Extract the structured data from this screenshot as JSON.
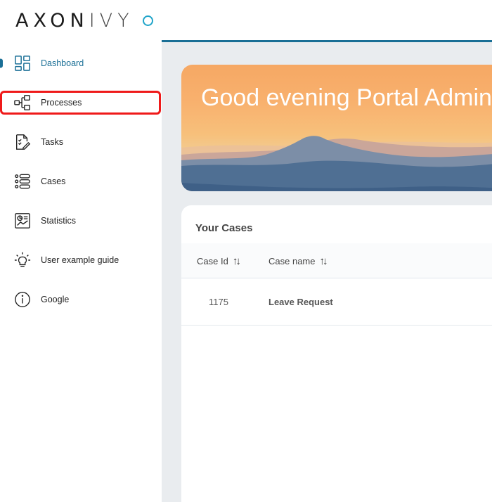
{
  "brand": {
    "logo_bold": "AXON",
    "logo_thin": "IVY",
    "accent_color": "#1a6f96",
    "highlight_color": "#ef1a1a"
  },
  "sidebar": {
    "items": [
      {
        "label": "Dashboard",
        "icon": "dashboard-icon",
        "active": true
      },
      {
        "label": "Processes",
        "icon": "processes-icon",
        "highlighted": true
      },
      {
        "label": "Tasks",
        "icon": "tasks-icon"
      },
      {
        "label": "Cases",
        "icon": "cases-icon"
      },
      {
        "label": "Statistics",
        "icon": "statistics-icon"
      },
      {
        "label": "User example guide",
        "icon": "lightbulb-icon"
      },
      {
        "label": "Google",
        "icon": "info-icon"
      }
    ]
  },
  "banner": {
    "greeting": "Good evening Portal Admin"
  },
  "cases": {
    "title": "Your Cases",
    "columns": [
      "Case Id",
      "Case name"
    ],
    "rows": [
      {
        "id": "1175",
        "name": "Leave Request"
      }
    ]
  }
}
